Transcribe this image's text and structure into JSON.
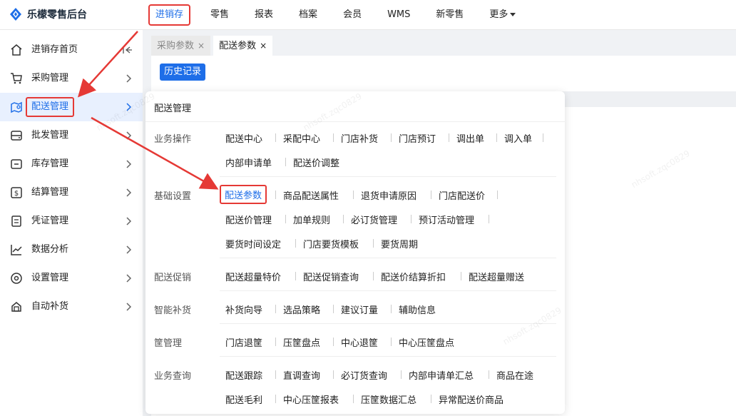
{
  "app": {
    "title": "乐檬零售后台"
  },
  "topnav": [
    {
      "label": "进销存",
      "active": true
    },
    {
      "label": "零售"
    },
    {
      "label": "报表"
    },
    {
      "label": "档案"
    },
    {
      "label": "会员"
    },
    {
      "label": "WMS"
    },
    {
      "label": "新零售"
    },
    {
      "label": "更多",
      "dropdown": true
    }
  ],
  "sidebar": {
    "items": [
      {
        "label": "进销存首页",
        "icon": "home-icon"
      },
      {
        "label": "采购管理",
        "icon": "cart-icon"
      },
      {
        "label": "配送管理",
        "icon": "delivery-icon",
        "active": true
      },
      {
        "label": "批发管理",
        "icon": "wholesale-icon"
      },
      {
        "label": "库存管理",
        "icon": "inventory-icon"
      },
      {
        "label": "结算管理",
        "icon": "settlement-icon"
      },
      {
        "label": "凭证管理",
        "icon": "voucher-icon"
      },
      {
        "label": "数据分析",
        "icon": "chart-icon"
      },
      {
        "label": "设置管理",
        "icon": "settings-icon"
      },
      {
        "label": "自动补货",
        "icon": "replenish-icon"
      }
    ]
  },
  "tabs": [
    {
      "label": "采购参数",
      "close": "×",
      "active": false
    },
    {
      "label": "配送参数",
      "close": "×",
      "active": true
    }
  ],
  "toolbar": {
    "history_label": "历史记录"
  },
  "menu": {
    "title": "配送管理",
    "sections": [
      {
        "label": "业务操作",
        "items": [
          "配送中心",
          "采配中心",
          "门店补货",
          "门店预订",
          "调出单",
          "调入单",
          "内部申请单",
          "配送价调整"
        ]
      },
      {
        "label": "基础设置",
        "items": [
          "配送参数",
          "商品配送属性",
          "退货申请原因",
          "门店配送价",
          "配送价管理",
          "加单规则",
          "必订货管理",
          "预订活动管理",
          "要货时间设定",
          "门店要货模板",
          "要货周期"
        ]
      },
      {
        "label": "配送促销",
        "items": [
          "配送超量特价",
          "配送促销查询",
          "配送价结算折扣",
          "配送超量赠送"
        ]
      },
      {
        "label": "智能补货",
        "items": [
          "补货向导",
          "选品策略",
          "建议订量",
          "辅助信息"
        ]
      },
      {
        "label": "筐管理",
        "items": [
          "门店退筐",
          "压筐盘点",
          "中心退筐",
          "中心压筐盘点"
        ]
      },
      {
        "label": "业务查询",
        "items": [
          "配送跟踪",
          "直调查询",
          "必订货查询",
          "内部申请单汇总",
          "商品在途",
          "配送毛利",
          "中心压筐报表",
          "压筐数据汇总",
          "异常配送价商品"
        ]
      }
    ]
  },
  "watermark": {
    "text": "nhsoft.zqc0829"
  },
  "colors": {
    "accent": "#1e6ee8",
    "annotation": "#e53935"
  }
}
